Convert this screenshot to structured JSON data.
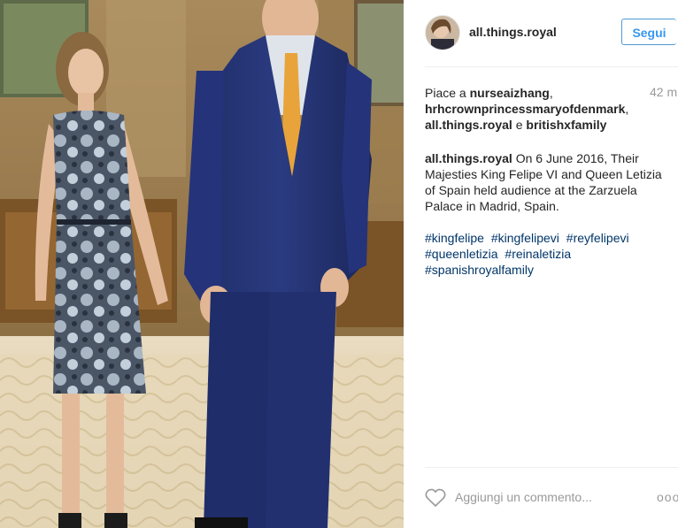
{
  "post": {
    "username": "all.things.royal",
    "follow_label": "Segui",
    "likes_prefix": "Piace a ",
    "liker_1": "nurseaizhang",
    "liker_sep_1": ",",
    "liker_2": "hrhcrownprincessmaryofdenmark",
    "liker_sep_2": ",",
    "liker_3": "all.things.royal",
    "liker_conj": " e ",
    "liker_4": "britishxfamily",
    "time": "42 m",
    "caption_user": "all.things.royal",
    "caption_text": " On 6 June 2016, Their Majesties King Felipe VI and Queen Letizia of Spain held audience at the Zarzuela Palace in Madrid, Spain.",
    "hashtags": [
      "#kingfelipe",
      "#kingfelipevi",
      "#reyfelipevi",
      "#queenletizia",
      "#reinaletizia",
      "#spanishroyalfamily"
    ],
    "comment_placeholder": "Aggiungi un commento...",
    "more_label": "ooo"
  },
  "icons": {
    "like": "heart-outline-icon",
    "more": "more-options-icon"
  },
  "colors": {
    "link_blue": "#3897f0",
    "hashtag": "#003569",
    "muted": "#999999"
  }
}
